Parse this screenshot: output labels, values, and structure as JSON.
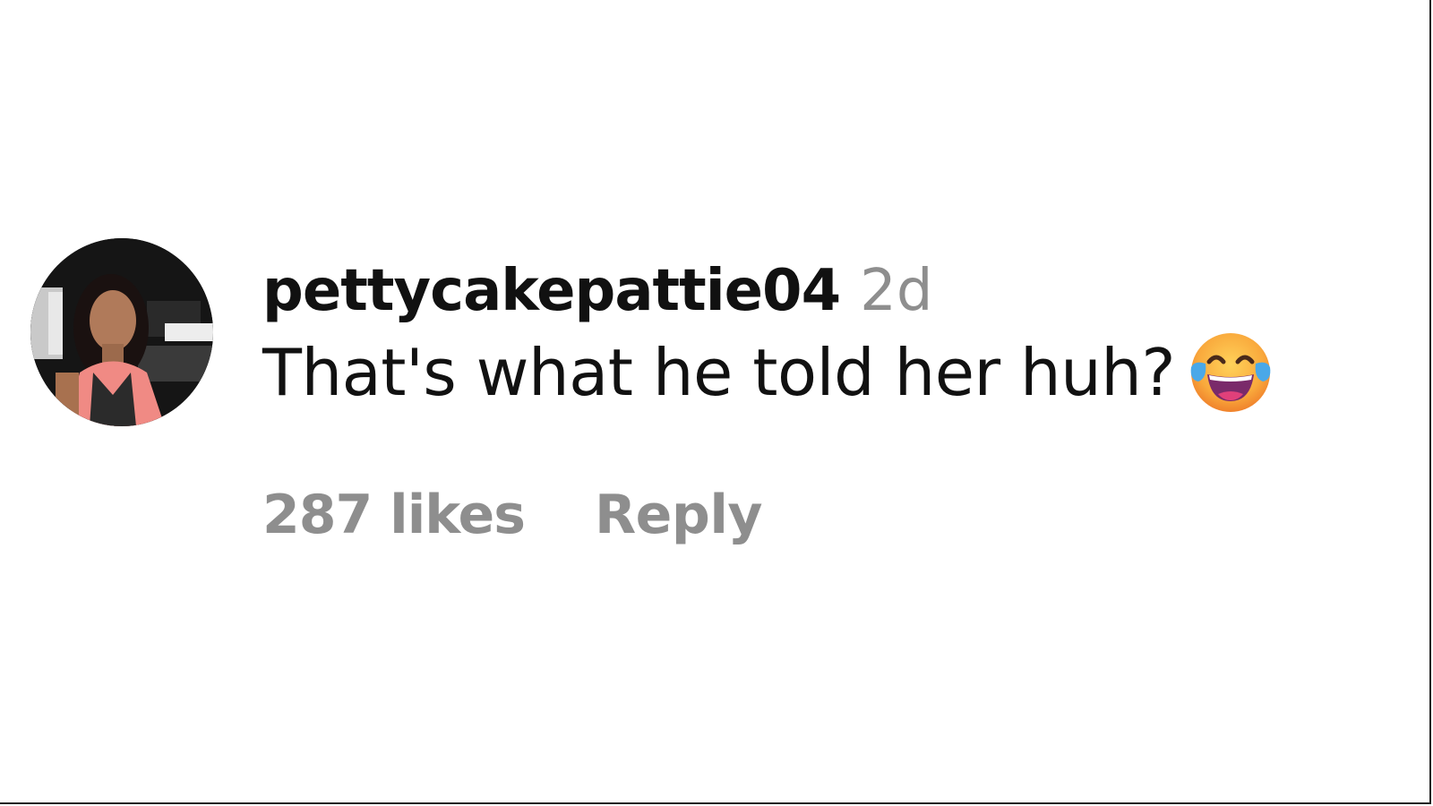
{
  "comment": {
    "username": "pettycakepattie04",
    "time_ago": "2d",
    "text": "That's what he told her huh?",
    "emoji": "face-with-tears-of-joy-icon",
    "likes": "287 likes",
    "reply_label": "Reply"
  },
  "colors": {
    "username": "#111111",
    "meta": "#8e8e8e",
    "background": "#ffffff"
  }
}
